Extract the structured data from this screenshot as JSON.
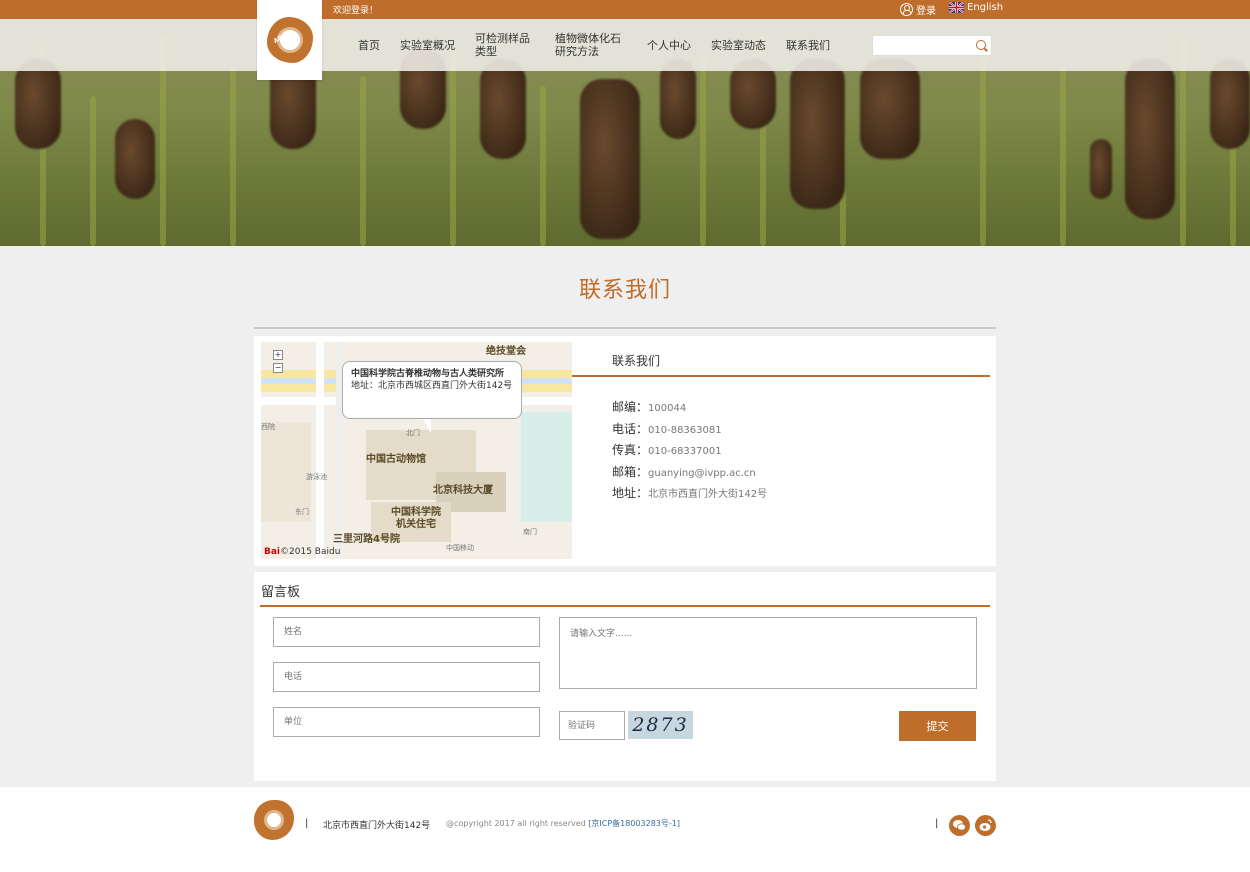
{
  "topbar": {
    "welcome": "欢迎登录！",
    "login": "登录",
    "language": "English"
  },
  "nav": {
    "items": [
      {
        "label": "首页"
      },
      {
        "label": "实验室概况"
      },
      {
        "label": "可检测样品\n类型"
      },
      {
        "label": "植物微体化石\n研究方法"
      },
      {
        "label": "个人中心"
      },
      {
        "label": "实验室动态"
      },
      {
        "label": "联系我们"
      }
    ],
    "logo_text": "ARAL"
  },
  "page": {
    "title": "联系我们"
  },
  "map": {
    "popup_title": "中国科学院古脊椎动物与古人类研究所",
    "popup_address": "地址：北京市西城区西直门外大街142号",
    "labels": [
      "绝技堂会",
      "中国古动物馆",
      "北京科技大厦",
      "中国科学院",
      "机关住宅",
      "三里河路4号院"
    ],
    "small_labels": [
      "北门",
      "东门",
      "南门",
      "中国移动",
      "游泳池",
      "西院"
    ],
    "baidu_copyright": "©2015 Baidu"
  },
  "contact": {
    "heading": "联系我们",
    "rows": [
      {
        "key": "邮编：",
        "value": "100044"
      },
      {
        "key": "电话：",
        "value": "010-88363081"
      },
      {
        "key": "传真：",
        "value": "010-68337001"
      },
      {
        "key": "邮箱：",
        "value": "guanying@ivpp.ac.cn"
      },
      {
        "key": "地址：",
        "value": "北京市西直门外大街142号"
      }
    ]
  },
  "board": {
    "heading": "留言板",
    "name_placeholder": "姓名",
    "phone_placeholder": "电话",
    "unit_placeholder": "单位",
    "message_placeholder": "请输入文字......",
    "captcha_placeholder": "验证码",
    "captcha_code": "2873",
    "submit": "提交"
  },
  "footer": {
    "address": "北京市西直门外大街142号",
    "copyright": "@copyright 2017 all right reserved ",
    "icp": "[京ICP备18003283号-1]",
    "separator": "|"
  },
  "colors": {
    "brand": "#bf6d2b",
    "background": "#efefef"
  }
}
